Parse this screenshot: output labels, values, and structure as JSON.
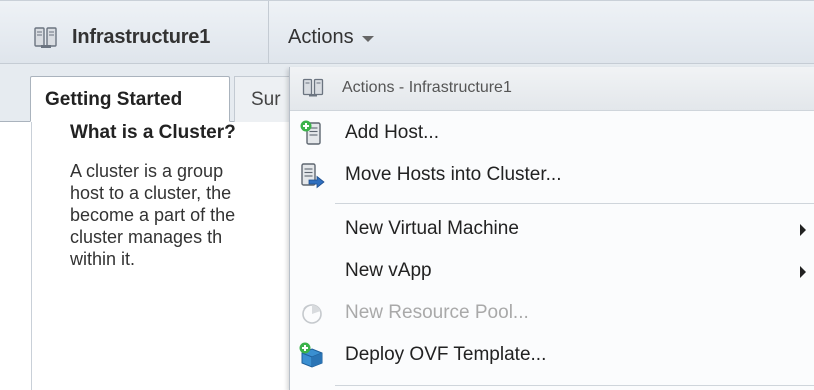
{
  "header": {
    "title": "Infrastructure1",
    "actions_label": "Actions"
  },
  "tabs": [
    {
      "label": "Getting Started",
      "active": true
    },
    {
      "label": "Sur",
      "active": false
    }
  ],
  "content": {
    "heading": "What is a Cluster?",
    "paragraph_lines": [
      "A cluster is a group",
      "host to a cluster, the",
      "become a part of the",
      "cluster manages th",
      "within it."
    ]
  },
  "menu": {
    "header_label": "Actions - Infrastructure1",
    "items": [
      {
        "label": "Add Host...",
        "icon": "add-host-icon",
        "enabled": true,
        "submenu": false
      },
      {
        "label": "Move Hosts into Cluster...",
        "icon": "move-hosts-icon",
        "enabled": true,
        "submenu": false
      },
      {
        "label": "New Virtual Machine",
        "icon": "",
        "enabled": true,
        "submenu": true
      },
      {
        "label": "New vApp",
        "icon": "",
        "enabled": true,
        "submenu": true
      },
      {
        "label": "New Resource Pool...",
        "icon": "resource-pool-icon",
        "enabled": false,
        "submenu": false
      },
      {
        "label": "Deploy OVF Template...",
        "icon": "deploy-ovf-icon",
        "enabled": true,
        "submenu": false
      }
    ]
  },
  "colors": {
    "header_bg": "#e4e9ee",
    "menu_bg": "#fbfcfd",
    "disabled_text": "#a9a9a9"
  }
}
